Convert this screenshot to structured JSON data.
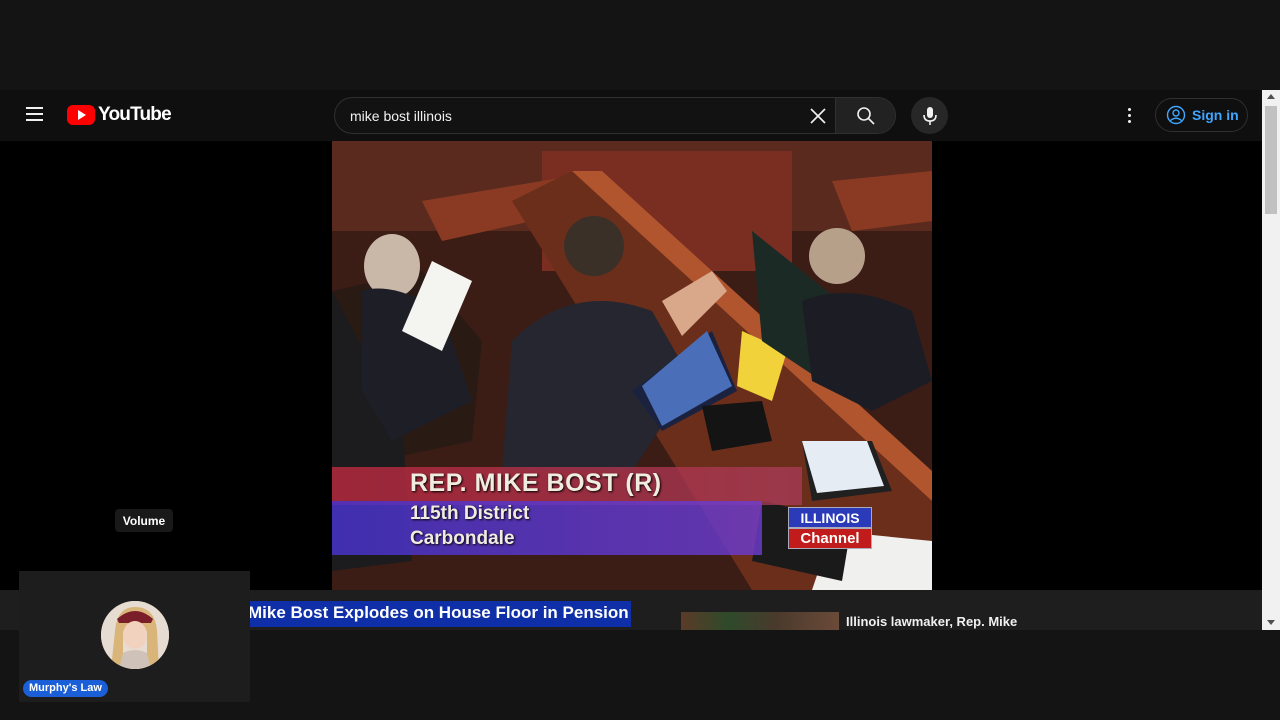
{
  "header": {
    "logo_text": "YouTube",
    "search": {
      "value": "mike bost illinois",
      "placeholder": "Search"
    },
    "sign_in_label": "Sign in"
  },
  "video": {
    "lower_third": {
      "name": "REP. MIKE BOST (R)",
      "district": "115th District",
      "city": "Carbondale"
    },
    "channel_logo": {
      "line1": "ILLINOIS",
      "line2": "Channel"
    },
    "volume_tooltip": "Volume"
  },
  "below_player": {
    "title_fragment": "Mike Bost Explodes on House Floor in Pension",
    "related_title": "Illinois lawmaker, Rep. Mike"
  },
  "channel_card": {
    "name": "Murphy's Law"
  },
  "colors": {
    "brand_red": "#ff0000",
    "link_blue": "#3ea6ff",
    "highlight_blue": "#0f2fa8"
  }
}
